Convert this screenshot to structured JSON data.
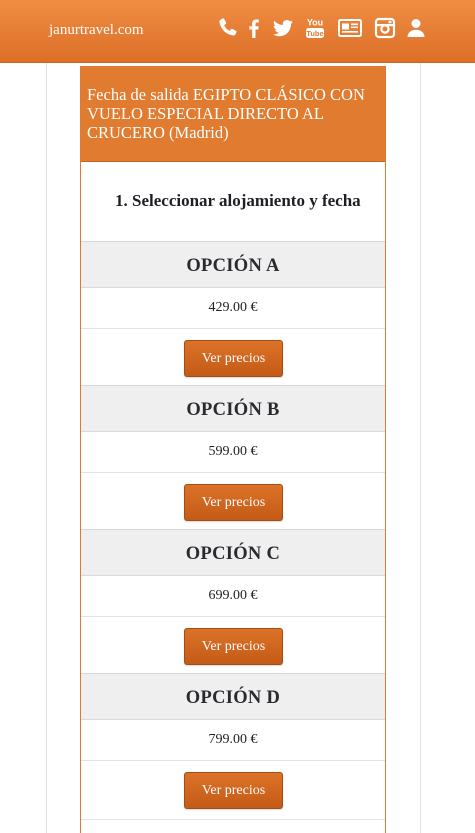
{
  "header": {
    "site": "janurtravel.com",
    "icons": [
      "phone-icon",
      "facebook-icon",
      "twitter-icon",
      "youtube-icon",
      "newspaper-icon",
      "instagram-icon",
      "user-icon"
    ],
    "youtube_text": {
      "top": "You",
      "bottom": "Tube"
    },
    "color": "#e57c32"
  },
  "card": {
    "title": "Fecha de salida EGIPTO CLÁSICO CON VUELO ESPECIAL DIRECTO AL CRUCERO (Madrid)",
    "step": "1. Seleccionar alojamiento y fecha",
    "accent": "#e07b30"
  },
  "options": [
    {
      "name": "OPCIÓN A",
      "price": "429.00 €",
      "button": "Ver precios"
    },
    {
      "name": "OPCIÓN B",
      "price": "599.00 €",
      "button": "Ver precios"
    },
    {
      "name": "OPCIÓN C",
      "price": "699.00 €",
      "button": "Ver precios"
    },
    {
      "name": "OPCIÓN D",
      "price": "799.00 €",
      "button": "Ver precios"
    }
  ]
}
